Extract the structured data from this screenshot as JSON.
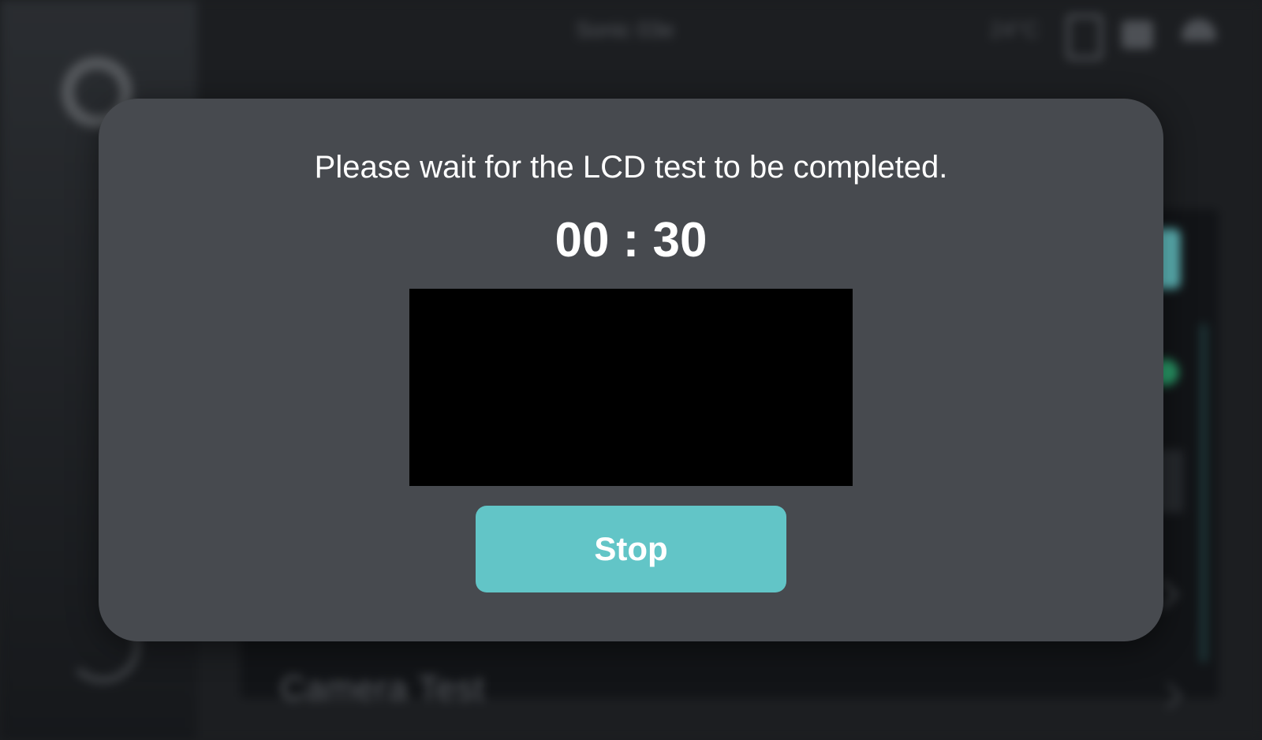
{
  "background": {
    "header_title": "Sonic 03e",
    "temperature": "24°C",
    "list_item_camera": "Camera Test",
    "icons": [
      "settings-icon",
      "back-icon",
      "tablet-icon",
      "lock-icon",
      "wifi-icon"
    ]
  },
  "dialog": {
    "message": "Please wait for the LCD test to be completed.",
    "timer": "00 : 30",
    "stop_label": "Stop",
    "lcd_test_color": "#000000"
  },
  "colors": {
    "accent": "#62c5c7",
    "dialog_bg": "#474a4f",
    "page_bg": "#1b1d20"
  }
}
